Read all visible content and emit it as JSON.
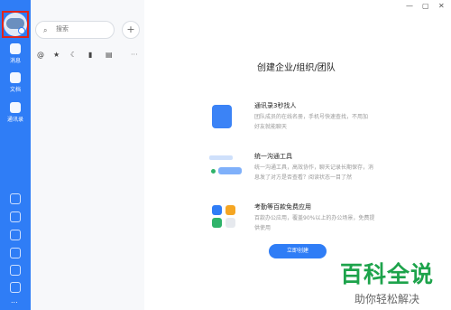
{
  "sidebar": {
    "items": [
      {
        "label": "消息",
        "icon": "message-icon"
      },
      {
        "label": "文档",
        "icon": "document-icon"
      },
      {
        "label": "通讯录",
        "icon": "contacts-icon"
      }
    ],
    "bottom_icons": [
      "workspace-icon",
      "todo-icon",
      "lightning-icon",
      "phone-icon",
      "mail-icon",
      "settings-icon",
      "more-icon"
    ],
    "more": "..."
  },
  "list_panel": {
    "search_placeholder": "搜索",
    "add_symbol": "+",
    "filter_symbols": [
      "@",
      "★",
      "☾",
      "▮",
      "▤",
      "···"
    ]
  },
  "window_controls": {
    "minimize": "—",
    "maximize": "▢",
    "close": "✕"
  },
  "main": {
    "title": "创建企业/组织/团队",
    "features": [
      {
        "title": "通讯录3秒找人",
        "desc_line1": "团队成员的在线名册，手机号快速查找，不用加",
        "desc_line2": "好友就能聊天"
      },
      {
        "title": "统一沟通工具",
        "desc_line1": "统一沟通工具，高效协作，聊天记录长期保存，消",
        "desc_line2": "息发了对方是否查看？阅读状态一目了然"
      },
      {
        "title": "考勤等百款免费应用",
        "desc_line1": "百款办公应用，覆盖90%以上的办公场景，免费提",
        "desc_line2": "供使用"
      }
    ],
    "cta": "立即创建"
  },
  "watermark": {
    "main": "百科全说",
    "sub": "助你轻松解决"
  },
  "colors": {
    "sidebar_bg": "#2f7df6",
    "accent": "#2f7df6",
    "watermark_green": "#1da34b",
    "highlight": "#e0251b"
  }
}
